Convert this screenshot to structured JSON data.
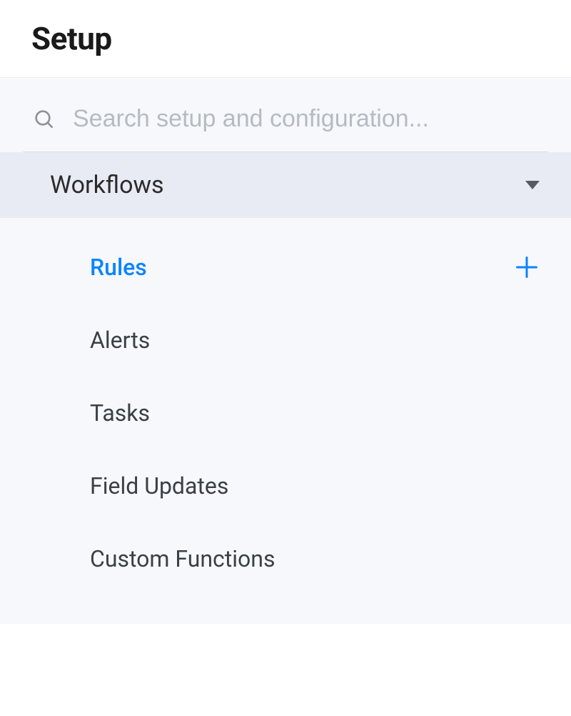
{
  "header": {
    "title": "Setup"
  },
  "search": {
    "placeholder": "Search setup and configuration..."
  },
  "section": {
    "title": "Workflows",
    "items": [
      {
        "label": "Rules",
        "active": true,
        "has_add": true
      },
      {
        "label": "Alerts"
      },
      {
        "label": "Tasks"
      },
      {
        "label": "Field Updates"
      },
      {
        "label": "Custom Functions"
      }
    ]
  },
  "colors": {
    "accent": "#0a84ff",
    "section_bg": "#e8ebf3",
    "page_bg": "#f6f8fb"
  }
}
